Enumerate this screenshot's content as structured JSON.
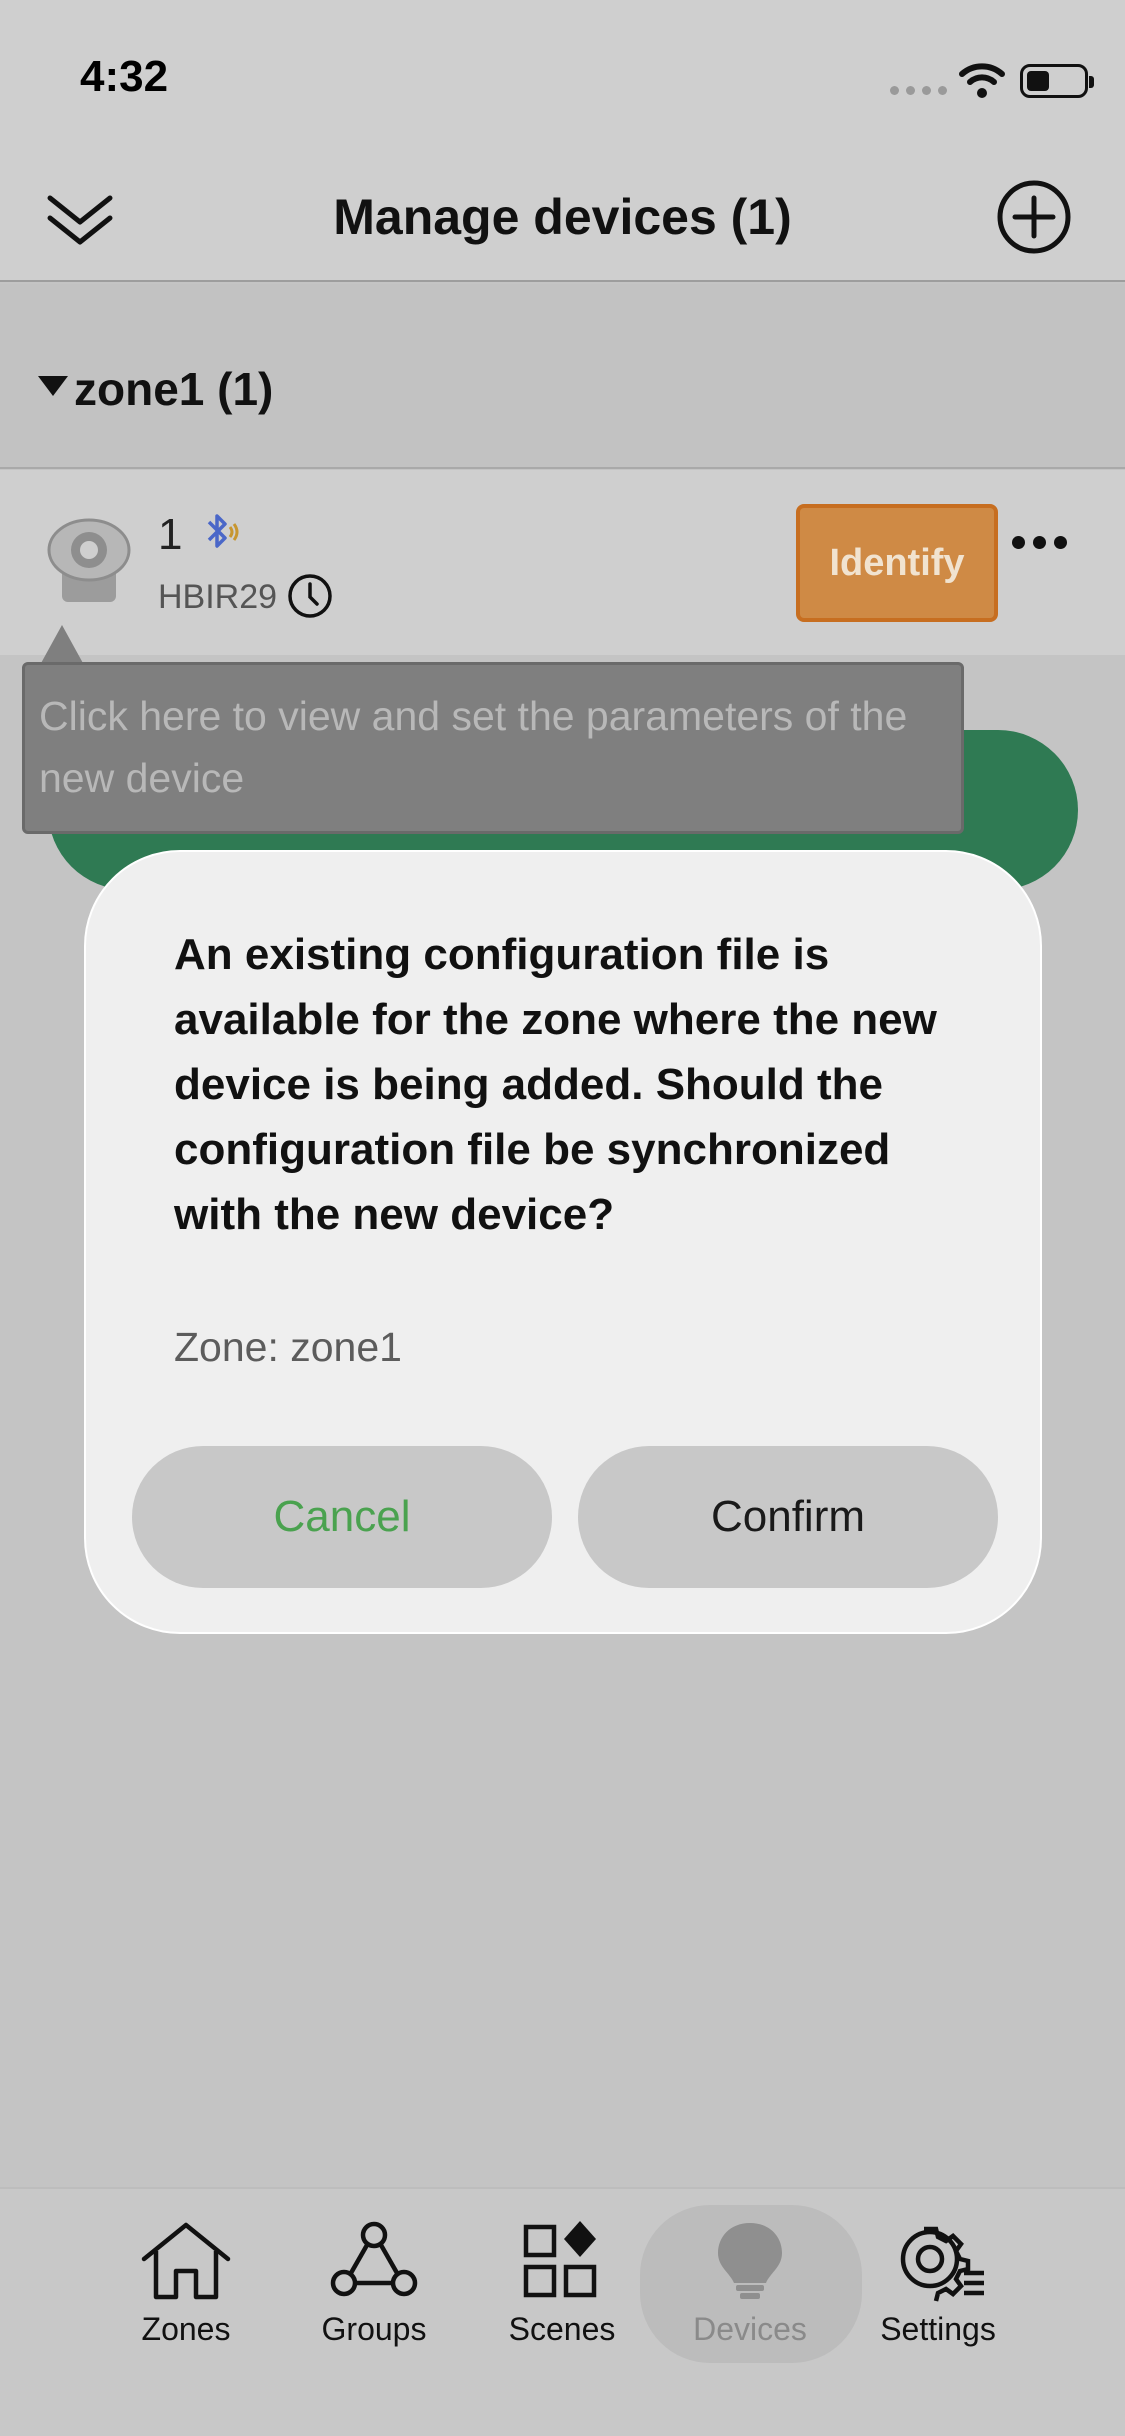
{
  "status_bar": {
    "time": "4:32"
  },
  "header": {
    "title": "Manage devices (1)"
  },
  "zone": {
    "label": "zone1 (1)"
  },
  "device": {
    "name": "1",
    "model": "HBIR29",
    "identify_label": "Identify"
  },
  "tooltip": {
    "text": "Click here to view and set the parameters of the new device"
  },
  "dialog": {
    "message": "An existing configuration file is available for the zone where the new device is being added. Should the configuration file be synchronized with the new device?",
    "zone_line": "Zone: zone1",
    "cancel_label": "Cancel",
    "confirm_label": "Confirm"
  },
  "tabs": [
    {
      "label": "Zones",
      "icon": "house-icon"
    },
    {
      "label": "Groups",
      "icon": "groups-icon"
    },
    {
      "label": "Scenes",
      "icon": "scenes-icon"
    },
    {
      "label": "Devices",
      "icon": "bulb-icon",
      "active": true
    },
    {
      "label": "Settings",
      "icon": "gear-icon"
    }
  ],
  "colors": {
    "identify": "#cf8a45",
    "accent_green": "#4aa24f",
    "pill_green": "#2f7a53"
  }
}
